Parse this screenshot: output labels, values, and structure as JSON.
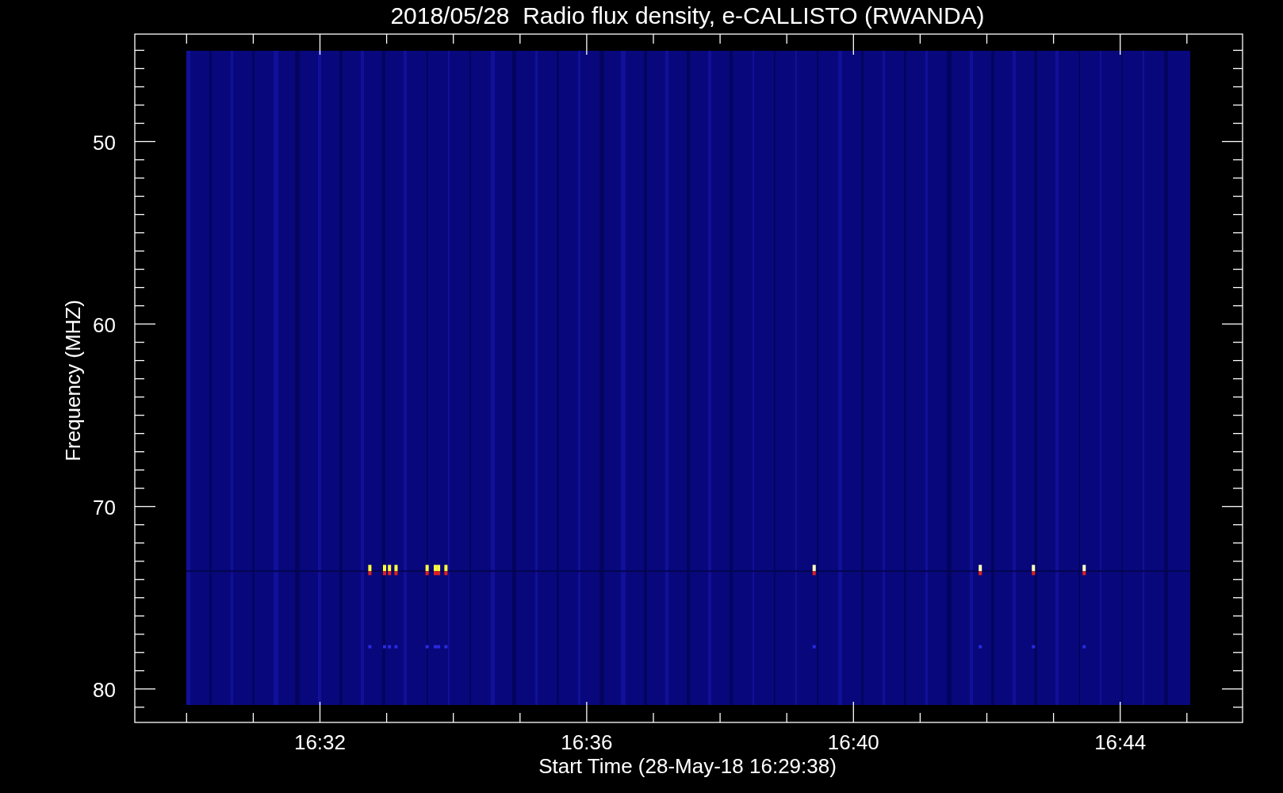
{
  "title": "2018/05/28  Radio flux density, e-CALLISTO (RWANDA)",
  "y_axis": {
    "label": "Frequency (MHZ)",
    "ticks": [
      "50",
      "60",
      "70",
      "80"
    ]
  },
  "x_axis": {
    "label": "Start Time (28-May-18 16:29:38)",
    "ticks": [
      "16:32",
      "16:36",
      "16:40",
      "16:44"
    ]
  }
}
